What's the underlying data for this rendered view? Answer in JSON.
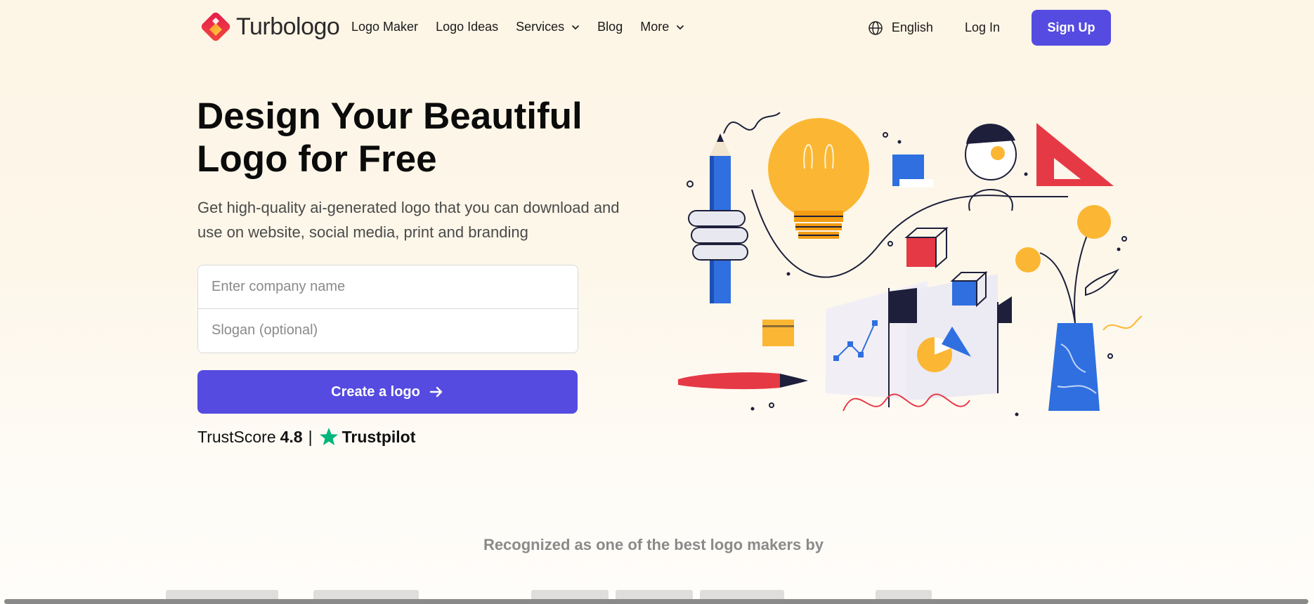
{
  "brand": {
    "name": "Turbologo",
    "accent": "#554be0"
  },
  "nav": {
    "items": [
      {
        "label": "Logo Maker",
        "has_dropdown": false
      },
      {
        "label": "Logo Ideas",
        "has_dropdown": false
      },
      {
        "label": "Services",
        "has_dropdown": true
      },
      {
        "label": "Blog",
        "has_dropdown": false
      },
      {
        "label": "More",
        "has_dropdown": true
      }
    ],
    "language": "English",
    "login": "Log In",
    "signup": "Sign Up"
  },
  "hero": {
    "title": "Design Your Beautiful Logo for Free",
    "subtitle": "Get high-quality ai-generated logo that you can download and use on website, social media, print and branding",
    "company_placeholder": "Enter company name",
    "slogan_placeholder": "Slogan (optional)",
    "cta": "Create a logo"
  },
  "trust": {
    "label": "TrustScore",
    "score": "4.8",
    "separator": "|",
    "provider": "Trustpilot",
    "star_color": "#00b67a"
  },
  "recognized": "Recognized as one of the best logo makers by"
}
